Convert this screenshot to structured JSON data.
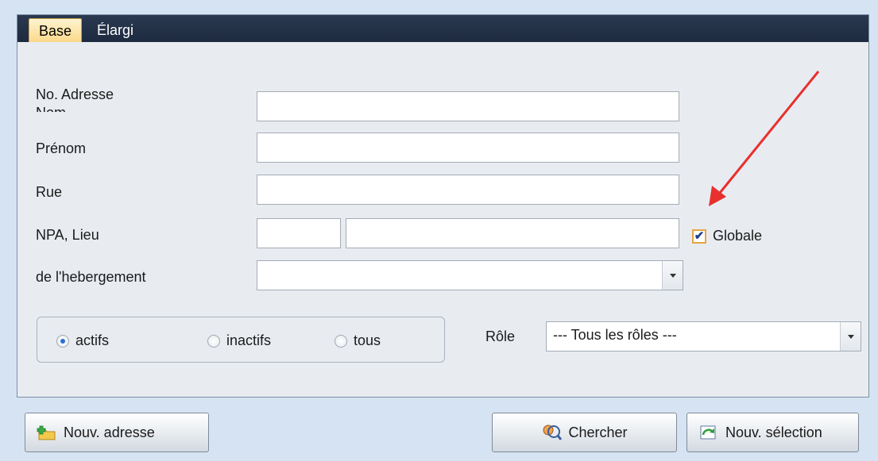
{
  "tabs": {
    "base": "Base",
    "elargi": "Élargi"
  },
  "form": {
    "no_adresse_label": "No. Adresse",
    "nom_label": "Nom",
    "prenom_label": "Prénom",
    "rue_label": "Rue",
    "npa_lieu_label": "NPA, Lieu",
    "hebergement_label": "de l'hebergement",
    "globale_label": "Globale",
    "globale_checked": true,
    "nom_value": "",
    "prenom_value": "",
    "rue_value": "",
    "npa_value": "",
    "lieu_value": "",
    "hebergement_value": ""
  },
  "status": {
    "actifs": "actifs",
    "inactifs": "inactifs",
    "tous": "tous",
    "selected": "actifs"
  },
  "role": {
    "label": "Rôle",
    "selected": "--- Tous les rôles ---"
  },
  "buttons": {
    "nouv_adresse": "Nouv. adresse",
    "chercher": "Chercher",
    "nouv_selection": "Nouv. sélection"
  },
  "icons": {
    "nouv_adresse": "folder-add-icon",
    "chercher": "search-people-icon",
    "nouv_selection": "refresh-selection-icon",
    "annotation": "red-arrow-annotation"
  },
  "colors": {
    "accent": "#2a6fd6",
    "tab_active": "#fbd98a",
    "tabbar": "#1d2a40",
    "annotation_arrow": "#e8302e"
  }
}
